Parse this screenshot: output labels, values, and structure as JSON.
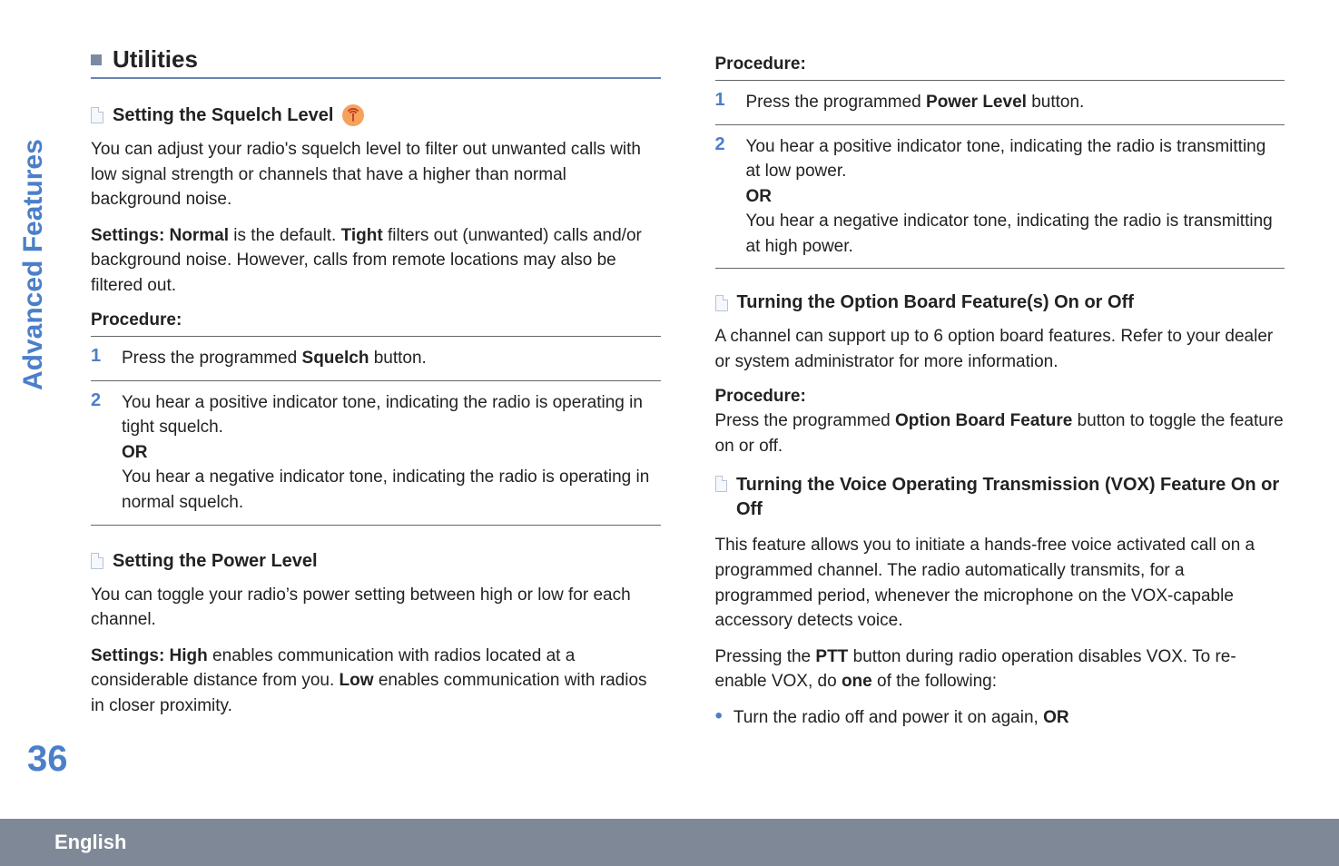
{
  "sidebar": {
    "label": "Advanced Features"
  },
  "page_number": "36",
  "language": "English",
  "left": {
    "section_title": "Utilities",
    "squelch": {
      "title": "Setting the Squelch Level",
      "p1": "You can adjust your radio's squelch level to filter out unwanted calls with low signal strength or channels that have a higher than normal background noise.",
      "p2_pre": "Settings: Normal",
      "p2_mid": " is the default. ",
      "p2_bold": "Tight",
      "p2_post": " filters out (unwanted) calls and/or background noise. However, calls from remote locations may also be filtered out.",
      "procedure_label": "Procedure:",
      "steps": {
        "1": {
          "pre": "Press the programmed ",
          "bold": "Squelch",
          "post": " button."
        },
        "2": {
          "line1": "You hear a positive indicator tone, indicating the radio is operating in tight squelch.",
          "or": "OR",
          "line2": "You hear a negative indicator tone, indicating the radio is operating in normal squelch."
        }
      }
    },
    "power": {
      "title": "Setting the Power Level",
      "p1": "You can toggle your radio’s power setting between high or low for each channel.",
      "p2_pre": "Settings:  High",
      "p2_mid": " enables communication with radios located at a considerable distance from you. ",
      "p2_bold": "Low",
      "p2_post": " enables communication with radios in closer proximity."
    }
  },
  "right": {
    "procedure_label": "Procedure:",
    "power_steps": {
      "1": {
        "pre": "Press the programmed ",
        "bold": "Power Level",
        "post": " button."
      },
      "2": {
        "line1": "You hear a positive indicator tone, indicating the radio is transmitting at low power.",
        "or": "OR",
        "line2": "You hear a negative indicator tone, indicating the radio is transmitting at high power."
      }
    },
    "option_board": {
      "title": "Turning the Option Board Feature(s) On or Off",
      "p1": "A channel can support up to 6 option board features. Refer to your dealer or system administrator for more information.",
      "procedure_label": "Procedure:",
      "proc_pre": "Press the programmed ",
      "proc_bold": "Option Board Feature",
      "proc_post": " button to toggle the feature on or off."
    },
    "vox": {
      "title": "Turning the Voice Operating Transmission (VOX) Feature On or Off",
      "p1": "This feature allows you to initiate a hands-free voice activated call on a programmed channel. The radio automatically transmits, for a programmed period, whenever the microphone on the VOX-capable accessory detects voice.",
      "p2_pre": "Pressing the ",
      "p2_b1": "PTT",
      "p2_mid": " button during radio operation disables VOX. To re-enable VOX, do ",
      "p2_b2": "one",
      "p2_post": " of the following:",
      "bullet1_pre": "Turn the radio off and power it on again, ",
      "bullet1_bold": "OR"
    }
  }
}
